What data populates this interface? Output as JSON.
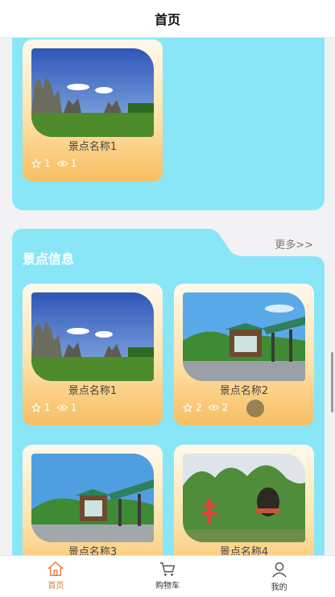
{
  "header": {
    "title": "首页"
  },
  "section": {
    "title": "景点信息",
    "more": "更多>>"
  },
  "top_card": {
    "name": "景点名称1",
    "likes": "1",
    "views": "1",
    "scene": "stone-forest"
  },
  "cards": [
    {
      "name": "景点名称1",
      "likes": "1",
      "views": "1",
      "scene": "stone-forest"
    },
    {
      "name": "景点名称2",
      "likes": "2",
      "views": "2",
      "scene": "pavilion"
    },
    {
      "name": "景点名称3",
      "likes": "",
      "views": "",
      "scene": "pavilion"
    },
    {
      "name": "景点名称4",
      "likes": "",
      "views": "",
      "scene": "karst-cave"
    }
  ],
  "nav": [
    {
      "label": "首页",
      "icon": "home-icon",
      "active": true
    },
    {
      "label": "购物车",
      "icon": "cart-icon",
      "active": false
    },
    {
      "label": "我的",
      "icon": "user-icon",
      "active": false
    }
  ],
  "colors": {
    "panel": "#88e6f7",
    "active_nav": "#e07b39",
    "card_gradient_end": "#f7be62"
  }
}
